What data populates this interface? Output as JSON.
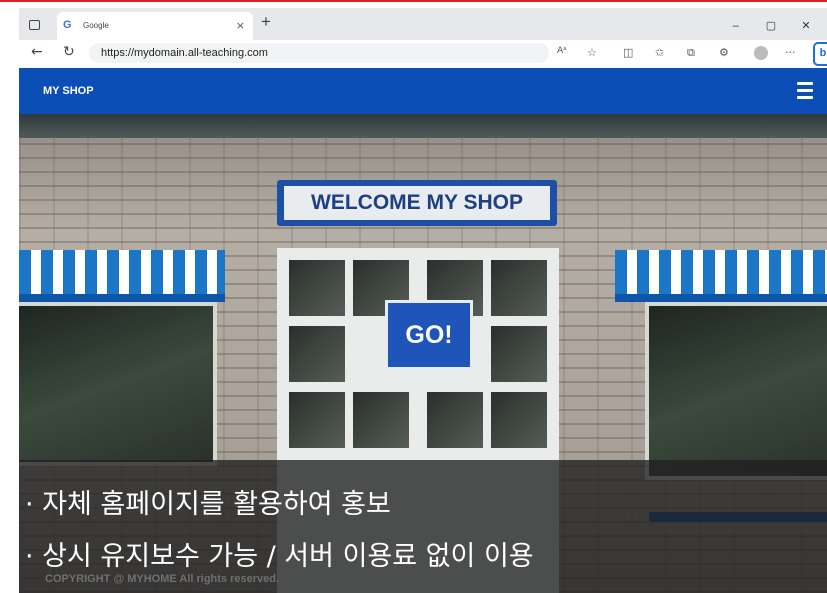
{
  "browser": {
    "tab_favicon": "G",
    "tab_title": "Google",
    "tab_close": "×",
    "new_tab": "+",
    "url": "https://mydomain.all-teaching.com",
    "window_controls": [
      "–",
      "▢",
      "✕"
    ],
    "more_label": "···",
    "read_aloud_label": "Aᵃ"
  },
  "site": {
    "brand": "MY SHOP",
    "sign_text": "WELCOME MY SHOP",
    "go_label": "GO!",
    "copyright": "COPYRIGHT @ MYHOME All rights reserved."
  },
  "overlay": {
    "line1": "· 자체 홈페이지를 활용하여 홍보",
    "line2": "· 상시 유지보수 가능 / 서버 이용료 없이 이용"
  },
  "colors": {
    "header_blue": "#0b4fb6",
    "accent_red": "#e02020",
    "awning_blue": "#1b76c8"
  },
  "icons": [
    "tabs-icon",
    "back-arrow-icon",
    "refresh-icon",
    "favorite-icon",
    "split-screen-icon",
    "favorites-bar-icon",
    "collections-icon",
    "extensions-icon",
    "profile-icon",
    "bing-icon",
    "hamburger-menu-icon"
  ]
}
